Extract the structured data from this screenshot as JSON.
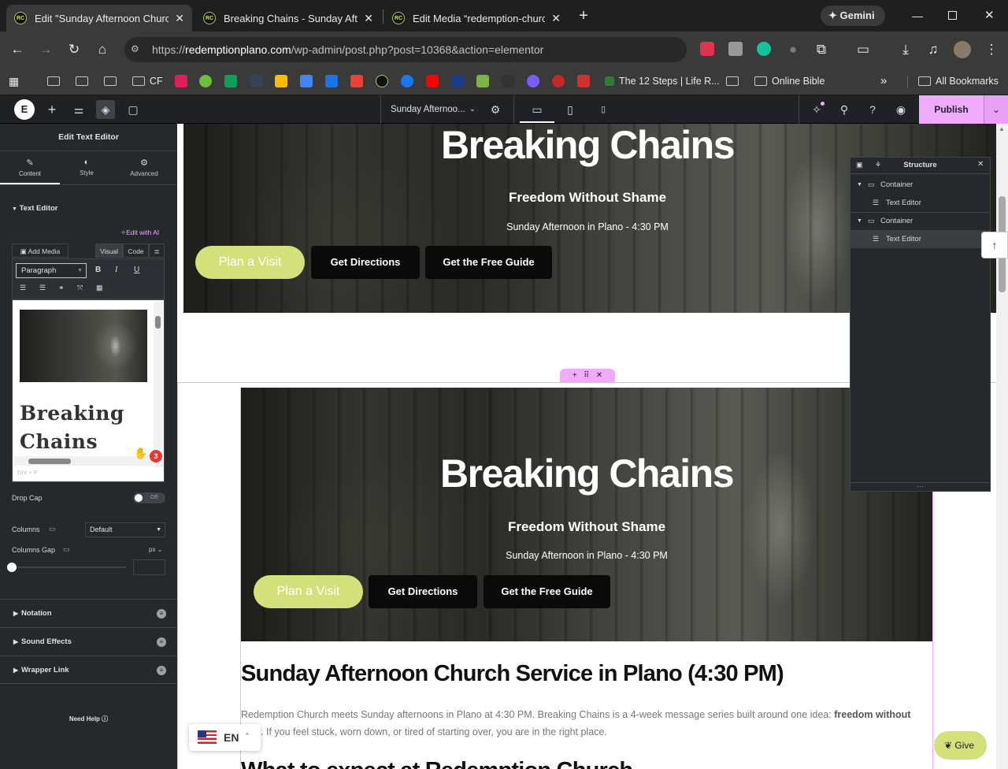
{
  "browser": {
    "tabs": [
      {
        "title": "Edit \"Sunday Afternoon Church",
        "active": true
      },
      {
        "title": "Breaking Chains - Sunday After",
        "active": false
      },
      {
        "title": "Edit Media “redemption-church",
        "active": false
      }
    ],
    "gemini_label": "Gemini",
    "url_scheme": "https://",
    "url_host": "redemptionplano.com",
    "url_path": "/wp-admin/post.php?post=10368&action=elementor",
    "bookmarks": {
      "cf": "CF",
      "twelve_steps": "The 12 Steps | Life R...",
      "online_bible": "Online Bible",
      "all_bookmarks": "All Bookmarks"
    }
  },
  "elementor_top": {
    "page_title": "Sunday Afternoo...",
    "publish_label": "Publish"
  },
  "panel": {
    "header": "Edit Text Editor",
    "tabs": [
      "Content",
      "Style",
      "Advanced"
    ],
    "section_text_editor": "Text Editor",
    "edit_with_ai": "Edit with AI",
    "add_media": "Add Media",
    "visual": "Visual",
    "code": "Code",
    "format_select": "Paragraph",
    "preview_heading": "Breaking Chains",
    "path_label": "DIV » P",
    "drop_cap_label": "Drop Cap",
    "drop_cap_toggle": "Off",
    "columns_label": "Columns",
    "columns_value": "Default",
    "columns_gap_label": "Columns Gap",
    "columns_gap_unit": "px",
    "sections": [
      "Notation",
      "Sound Effects",
      "Wrapper Link"
    ],
    "need_help": "Need Help"
  },
  "canvas": {
    "hero_title": "Breaking Chains",
    "hero_sub": "Freedom Without Shame",
    "hero_time": "Sunday Afternoon in Plano - 4:30 PM",
    "btn_visit": "Plan a Visit",
    "btn_directions": "Get Directions",
    "btn_guide": "Get the Free Guide",
    "h1": "Sunday Afternoon Church Service in Plano (4:30 PM)",
    "body_a": "Redemption Church meets Sunday afternoons in Plano at 4:30 PM. Breaking Chains is a 4-week message series built around one idea: ",
    "body_bold": "freedom without",
    "body_line2_bold": "ame",
    "body_b": ". If you feel stuck, worn down, or tired of starting over, you are in the right place.",
    "h2_partial": "What to expect at Redemption Church",
    "lang": "EN",
    "give": "Give",
    "badge_count": "3"
  },
  "structure": {
    "title": "Structure",
    "items": [
      {
        "label": "Container",
        "level": 0
      },
      {
        "label": "Text Editor",
        "level": 1
      },
      {
        "label": "Container",
        "level": 0
      },
      {
        "label": "Text Editor",
        "level": 1
      }
    ]
  },
  "colors": {
    "publish": "#f0abfc",
    "accent_green": "#d4e07a",
    "selection": "#f0abfc"
  }
}
